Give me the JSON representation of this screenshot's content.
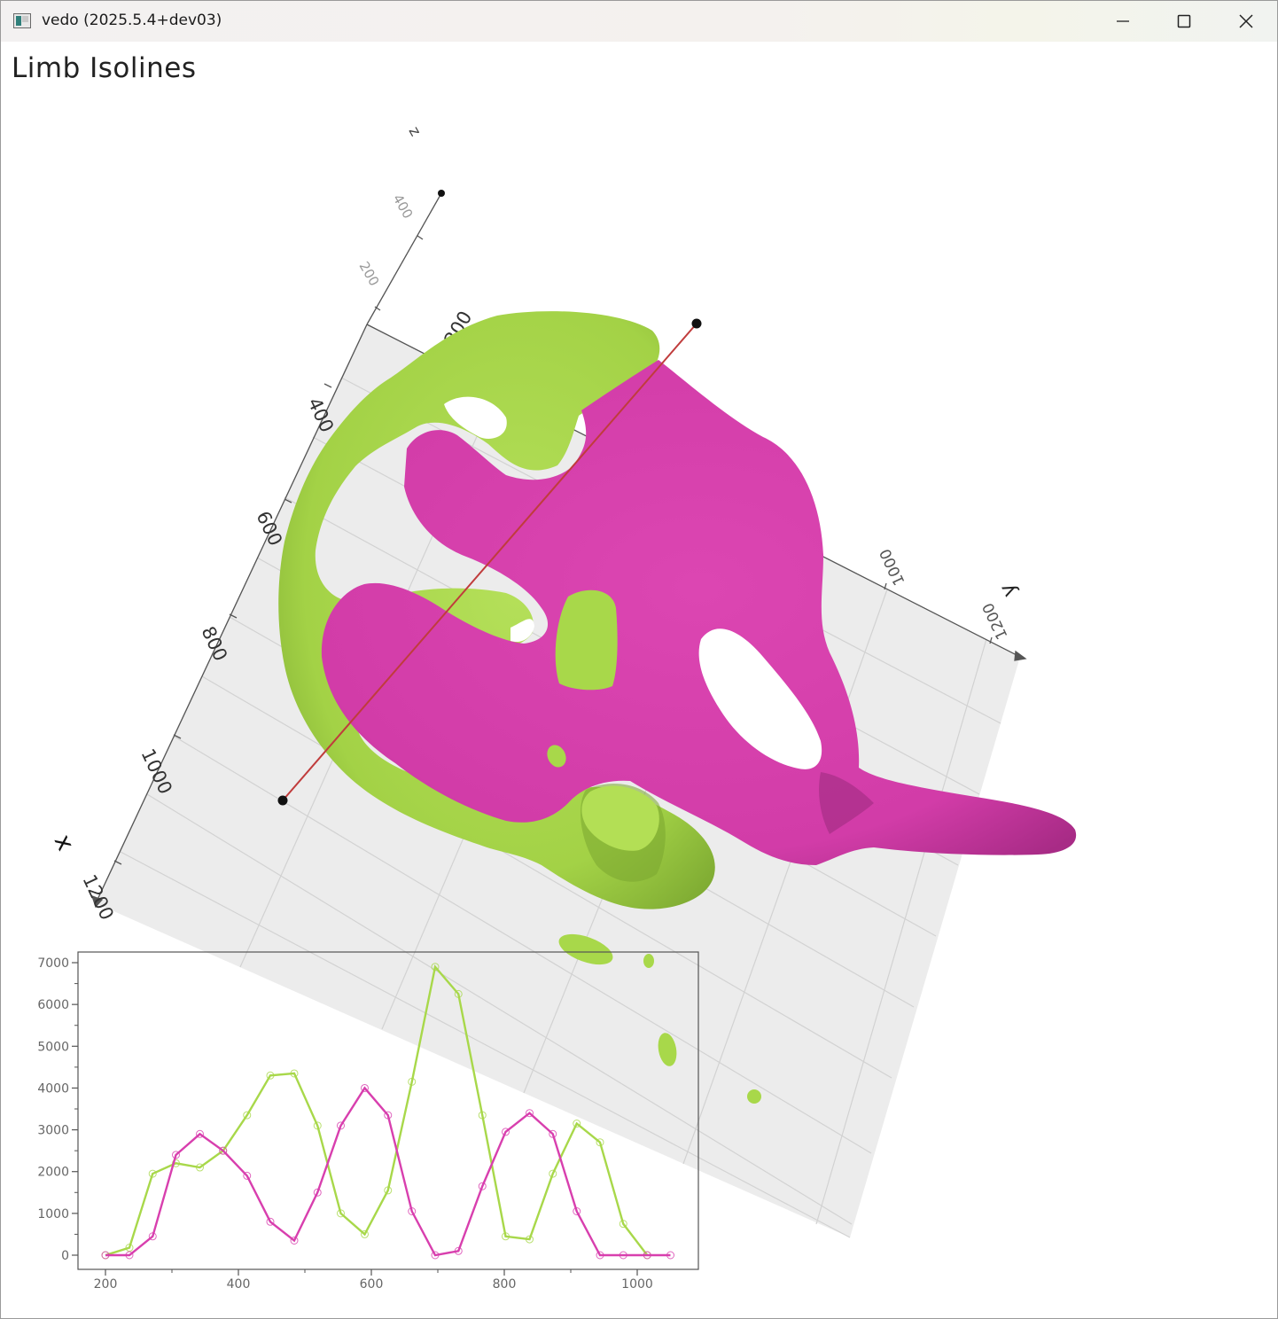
{
  "window": {
    "title": "vedo (2025.5.4+dev03)",
    "controls": [
      "minimize",
      "maximize",
      "close"
    ]
  },
  "scene": {
    "title": "Limb Isolines",
    "colors": {
      "isosurface_green": "#a8d84a",
      "isosurface_magenta": "#d83fae",
      "slicing_line": "#c03c3c",
      "grid_plane": "#ececec",
      "axis": "#555555"
    },
    "axes": {
      "x": {
        "title": "x",
        "ticks": [
          "400",
          "600",
          "800",
          "1000",
          "1200"
        ]
      },
      "y": {
        "title": "y",
        "ticks": [
          "200",
          "1000",
          "1200"
        ]
      },
      "z": {
        "title": "z",
        "ticks": [
          "200",
          "400"
        ]
      }
    }
  },
  "chart_data": {
    "type": "line",
    "xlim": [
      160,
      1040
    ],
    "ylim": [
      -300,
      7600
    ],
    "xticks": [
      "200",
      "400",
      "600",
      "800",
      "1000"
    ],
    "yticks": [
      "0",
      "1000",
      "2000",
      "3000",
      "4000",
      "5000",
      "6000",
      "7000"
    ],
    "series": [
      {
        "color": "#a8d84a",
        "x": [
          200,
          236,
          271,
          306,
          342,
          377,
          413,
          448,
          484,
          519,
          554,
          590,
          625,
          661,
          696,
          731,
          767,
          802,
          838,
          873,
          909,
          944,
          979,
          1015
        ],
        "y": [
          0,
          180,
          1950,
          2200,
          2100,
          2500,
          3350,
          4300,
          4350,
          3100,
          1000,
          500,
          1550,
          4150,
          6900,
          6250,
          3350,
          450,
          380,
          1950,
          3150,
          2700,
          750,
          0
        ]
      },
      {
        "color": "#d83fae",
        "x": [
          200,
          236,
          271,
          306,
          342,
          377,
          413,
          448,
          484,
          519,
          554,
          590,
          625,
          661,
          696,
          731,
          767,
          802,
          838,
          873,
          909,
          944,
          979,
          1015,
          1050
        ],
        "y": [
          0,
          0,
          450,
          2400,
          2900,
          2500,
          1900,
          800,
          350,
          1500,
          3100,
          4000,
          3350,
          1050,
          0,
          100,
          1650,
          2950,
          3400,
          2900,
          1050,
          0,
          0,
          0,
          0
        ]
      }
    ]
  }
}
